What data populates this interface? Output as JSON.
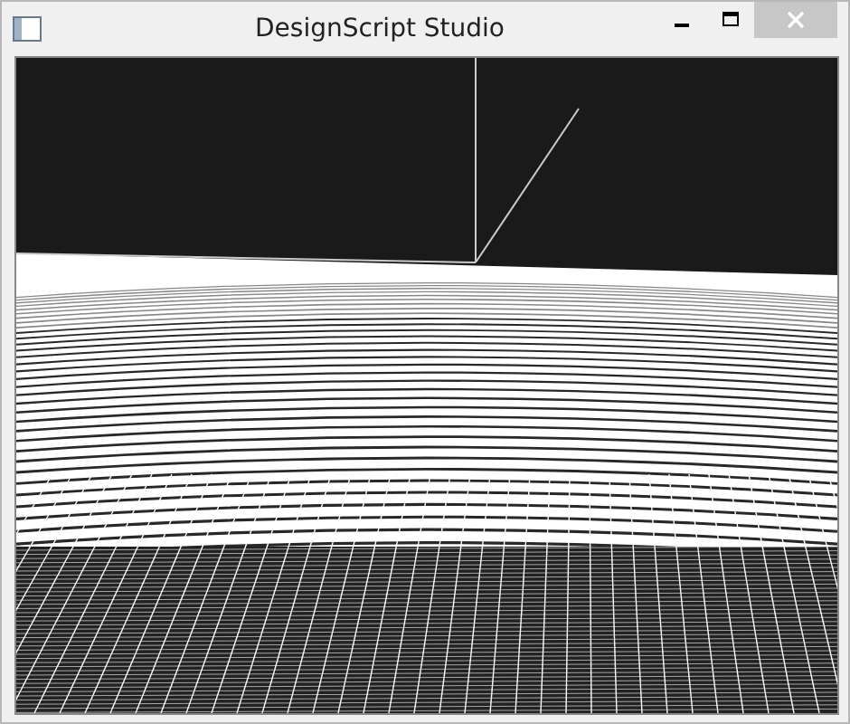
{
  "window": {
    "title": "DesignScript Studio"
  }
}
